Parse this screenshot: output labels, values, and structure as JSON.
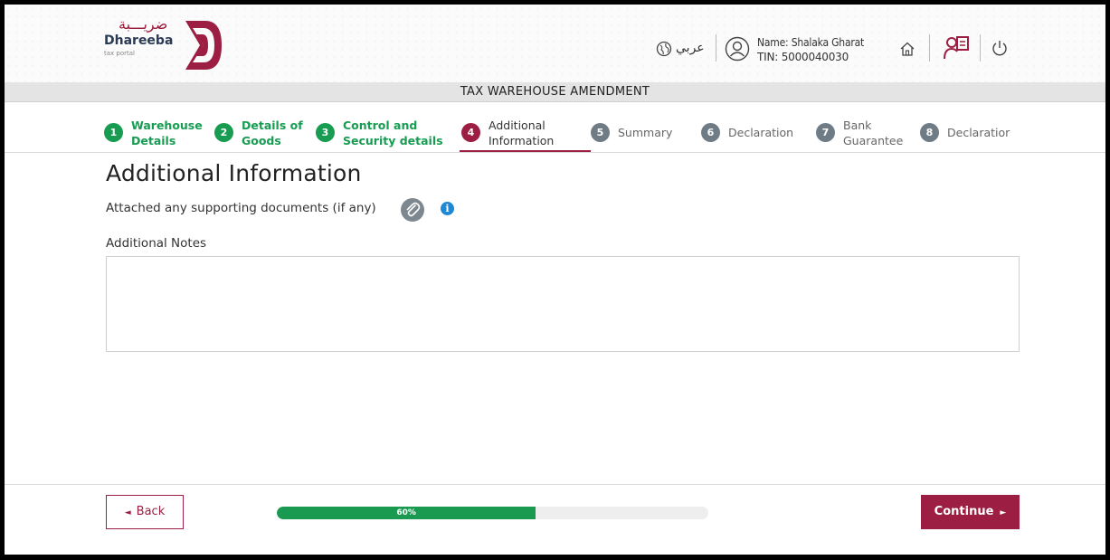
{
  "header": {
    "logo": {
      "arabic": "ضريـــبة",
      "name": "Dhareeba",
      "subtitle": "tax portal"
    },
    "language_label": "عربي",
    "user": {
      "name": "Name: Shalaka Gharat",
      "tin": "TIN: 5000040030"
    },
    "icons": [
      "globe-icon",
      "user-icon",
      "home-icon",
      "dashboard-icon",
      "power-icon"
    ]
  },
  "title_bar": "TAX WAREHOUSE AMENDMENT",
  "steps": [
    {
      "number": "1",
      "line1": "Warehouse",
      "line2": "Details",
      "state": "done"
    },
    {
      "number": "2",
      "line1": "Details of",
      "line2": "Goods",
      "state": "done"
    },
    {
      "number": "3",
      "line1": "Control and",
      "line2": "Security details",
      "state": "done"
    },
    {
      "number": "4",
      "line1": "Additional",
      "line2": "Information",
      "state": "active"
    },
    {
      "number": "5",
      "line1": "Summary",
      "line2": "",
      "state": "todo"
    },
    {
      "number": "6",
      "line1": "Declaration",
      "line2": "",
      "state": "todo"
    },
    {
      "number": "7",
      "line1": "Bank",
      "line2": "Guarantee",
      "state": "todo"
    },
    {
      "number": "8",
      "line1": "Declaratior",
      "line2": "",
      "state": "todo"
    }
  ],
  "content": {
    "title": "Additional Information",
    "attach_label": "Attached any supporting documents (if any)",
    "notes_label": "Additional Notes",
    "notes_value": "",
    "notes_placeholder": ""
  },
  "footer": {
    "back_label": "Back",
    "continue_label": "Continue",
    "progress_text": "60%",
    "progress_fraction": 0.6
  },
  "colors": {
    "brand": "#9c1f43",
    "done": "#179c52",
    "todo": "#6f7c86",
    "progress": "#1a9a50"
  }
}
